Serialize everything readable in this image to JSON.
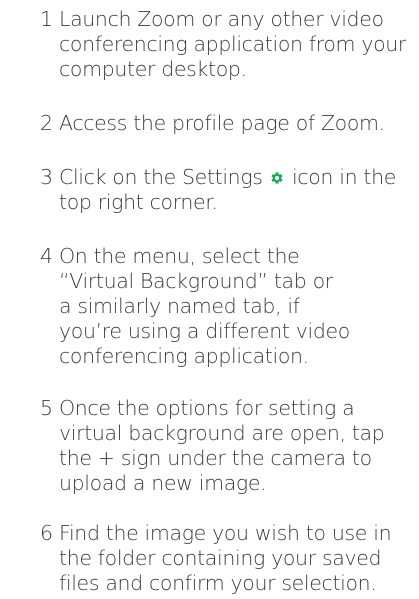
{
  "steps": [
    {
      "number": "1",
      "lines": [
        "Launch Zoom or any other video",
        "conferencing application from your",
        "computer desktop."
      ]
    },
    {
      "number": "2",
      "lines": [
        "Access the profile page of Zoom."
      ]
    },
    {
      "number": "3",
      "line1_before_icon": "Click on the Settings",
      "line1_after_icon": "icon in the",
      "lines_rest": [
        "top right corner."
      ],
      "icon": "gear-icon",
      "icon_color": "#1aaa55"
    },
    {
      "number": "4",
      "lines": [
        "On the menu, select the",
        "“Virtual Background” tab or",
        "a similarly named tab, if",
        "you’re using a different video",
        "conferencing application."
      ]
    },
    {
      "number": "5",
      "lines": [
        "Once the options for setting a",
        "virtual background are open, tap",
        "the + sign under the camera to",
        "upload a new image."
      ]
    },
    {
      "number": "6",
      "lines": [
        "Find the image you wish to use in",
        "the folder containing your saved",
        "files and confirm your selection."
      ]
    }
  ],
  "colors": {
    "text": "#3b3b3b",
    "accent": "#1aaa55"
  }
}
